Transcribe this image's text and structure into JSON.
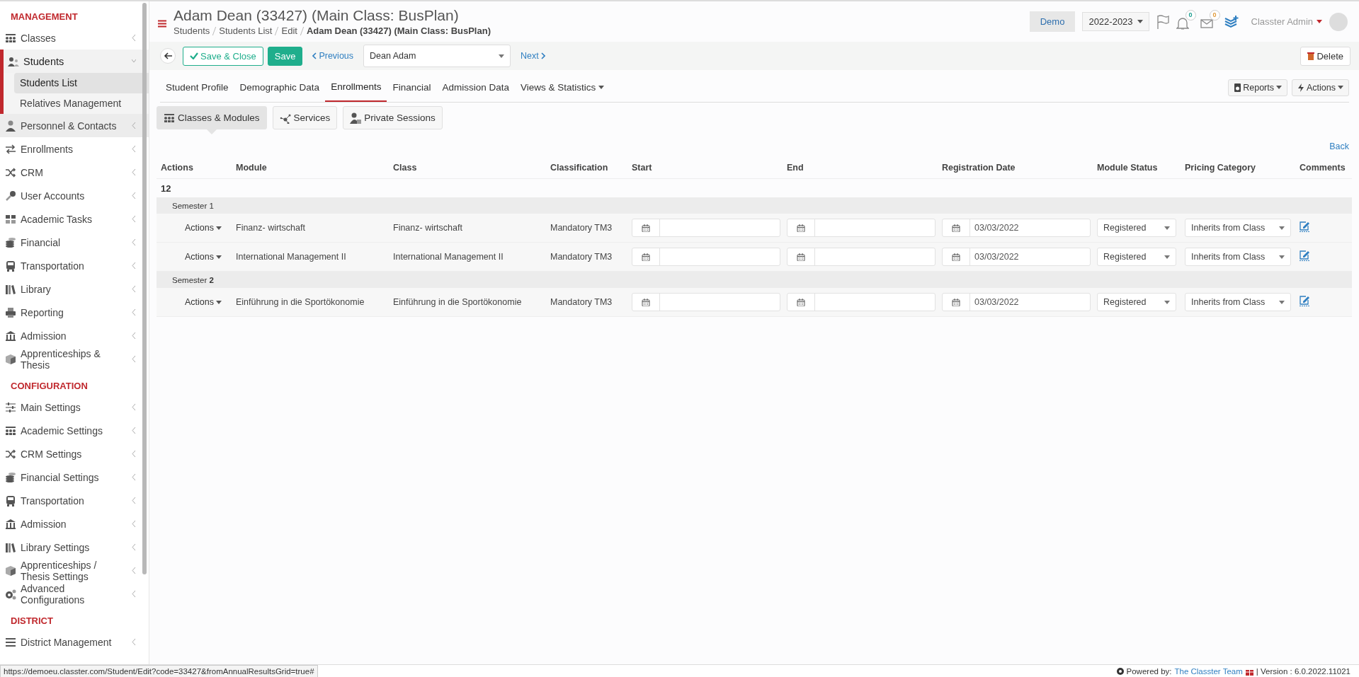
{
  "sidebar": {
    "sections": [
      {
        "title": "MANAGEMENT",
        "items": [
          {
            "label": "Classes",
            "expanded": false,
            "hovered": false
          },
          {
            "label": "Students",
            "expanded": true,
            "hovered": false,
            "children": [
              {
                "label": "Students List",
                "selected": true
              },
              {
                "label": "Relatives Management",
                "selected": false
              }
            ]
          },
          {
            "label": "Personnel & Contacts",
            "expanded": false,
            "hovered": true
          },
          {
            "label": "Enrollments",
            "expanded": false,
            "hovered": false
          },
          {
            "label": "CRM",
            "expanded": false,
            "hovered": false
          },
          {
            "label": "User Accounts",
            "expanded": false,
            "hovered": false
          },
          {
            "label": "Academic Tasks",
            "expanded": false,
            "hovered": false
          },
          {
            "label": "Financial",
            "expanded": false,
            "hovered": false
          },
          {
            "label": "Transportation",
            "expanded": false,
            "hovered": false
          },
          {
            "label": "Library",
            "expanded": false,
            "hovered": false
          },
          {
            "label": "Reporting",
            "expanded": false,
            "hovered": false
          },
          {
            "label": "Admission",
            "expanded": false,
            "hovered": false
          },
          {
            "label": "Apprenticeships & Thesis",
            "expanded": false,
            "hovered": false
          }
        ]
      },
      {
        "title": "CONFIGURATION",
        "items": [
          {
            "label": "Main Settings",
            "expanded": false,
            "hovered": false
          },
          {
            "label": "Academic Settings",
            "expanded": false,
            "hovered": false
          },
          {
            "label": "CRM Settings",
            "expanded": false,
            "hovered": false
          },
          {
            "label": "Financial Settings",
            "expanded": false,
            "hovered": false
          },
          {
            "label": "Transportation",
            "expanded": false,
            "hovered": false
          },
          {
            "label": "Admission",
            "expanded": false,
            "hovered": false
          },
          {
            "label": "Library Settings",
            "expanded": false,
            "hovered": false
          },
          {
            "label": "Apprenticeships / Thesis Settings",
            "expanded": false,
            "hovered": false
          },
          {
            "label": "Advanced Configurations",
            "expanded": false,
            "hovered": false
          }
        ]
      },
      {
        "title": "DISTRICT",
        "items": [
          {
            "label": "District Management",
            "expanded": false,
            "hovered": false
          }
        ]
      }
    ]
  },
  "header": {
    "title": "Adam Dean (33427) (Main Class: BusPlan)",
    "breadcrumbs": [
      "Students",
      "Students List",
      "Edit",
      "Adam Dean (33427) (Main Class: BusPlan)"
    ],
    "environment": "Demo",
    "year": "2022-2023",
    "notifications": "0",
    "messages": "0",
    "user": "Classter Admin"
  },
  "toolbar": {
    "save_close": "Save & Close",
    "save": "Save",
    "previous": "Previous",
    "student": "Dean Adam",
    "next": "Next",
    "delete": "Delete"
  },
  "tabs": [
    {
      "label": "Student Profile",
      "selected": false,
      "dropdown": false
    },
    {
      "label": "Demographic Data",
      "selected": false,
      "dropdown": false
    },
    {
      "label": "Enrollments",
      "selected": true,
      "dropdown": false
    },
    {
      "label": "Financial",
      "selected": false,
      "dropdown": false
    },
    {
      "label": "Admission Data",
      "selected": false,
      "dropdown": false
    },
    {
      "label": "Views & Statistics",
      "selected": false,
      "dropdown": true
    }
  ],
  "tab_actions": [
    "Reports",
    "Actions"
  ],
  "subtabs": [
    {
      "label": "Classes & Modules",
      "selected": true
    },
    {
      "label": "Services",
      "selected": false
    },
    {
      "label": "Private Sessions",
      "selected": false
    }
  ],
  "back_link": "Back",
  "table": {
    "columns": [
      "Actions",
      "Module",
      "Class",
      "Classification",
      "Start",
      "End",
      "Registration Date",
      "Module Status",
      "Pricing Category",
      "Comments"
    ],
    "count": "12",
    "groups": [
      {
        "label": "Semester 1",
        "rows": [
          {
            "actions": "Actions",
            "module": "Finanz- wirtschaft",
            "class": "Finanz- wirtschaft",
            "classification": "Mandatory TM3",
            "registration_date": "03/03/2022",
            "status": "Registered",
            "pricing": "Inherits from Class"
          },
          {
            "actions": "Actions",
            "module": "International Management II",
            "class": "International Management II",
            "classification": "Mandatory TM3",
            "registration_date": "03/03/2022",
            "status": "Registered",
            "pricing": "Inherits from Class"
          }
        ]
      },
      {
        "label": "Semester **2**",
        "rows": [
          {
            "actions": "Actions",
            "module": "Einführung in die Sportökonomie",
            "class": "Einführung in die Sportökonomie",
            "classification": "Mandatory TM3",
            "registration_date": "03/03/2022",
            "status": "Registered",
            "pricing": "Inherits from Class"
          }
        ]
      }
    ]
  },
  "status_bar": {
    "url": "https://demoeu.classter.com/Student/Edit?code=33427&fromAnnualResultsGrid=true#",
    "powered_by": "Powered by:",
    "team": "The Classter Team",
    "version": "| Version : 6.0.2022.11021"
  }
}
